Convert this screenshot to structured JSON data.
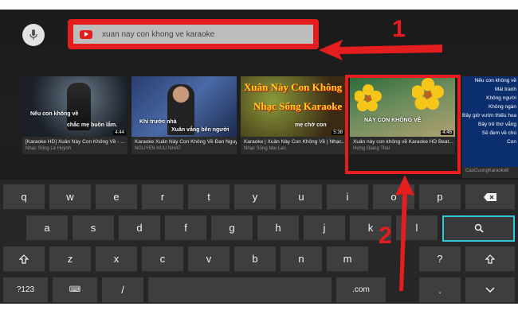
{
  "search": {
    "query": "xuan nay con khong ve karaoke"
  },
  "annotations": {
    "one": "1",
    "two": "2"
  },
  "videos": [
    {
      "title": "[Karaoke HD] Xuân Này Con Không Về - ...",
      "channel": "Nhạc Sống Lê Huỳnh",
      "duration": "4:44",
      "captions": [
        "Nếu con không về",
        "chắc mẹ buồn lắm."
      ]
    },
    {
      "title": "Karaoke Xuân Này Con Không Về Đan Nguyên",
      "channel": "NGUYEN HUU NHAT",
      "duration": "",
      "captions": [
        "Khi trước nhà",
        "Xuân vắng bên người"
      ]
    },
    {
      "title": "Karaoke | Xuân Này Con Không Về | Nhạc...",
      "channel": "Nhạc Sống Mai Lan",
      "duration": "5:38",
      "captions": [
        "Xuân Này Con Không Về",
        "Nhạc Sống Karaoke",
        "mẹ chờ con"
      ]
    },
    {
      "title": "Xuân này con không về  Karaoke HD   Beat...",
      "channel": "Hưng Giang Thái",
      "duration": "4:46",
      "captions": [
        "NÀY CON KHÔNG VỀ"
      ]
    }
  ],
  "side_video": {
    "lines": [
      "Nếu con không về",
      "Mái tranh",
      "Không người",
      "Không ngàn",
      "Bây giờ vườn thiếu hoa",
      "Bây trẻ thơ vắng",
      "Sẽ đem về chú",
      "Con"
    ],
    "channel": "CaoCuongKaraoke8"
  },
  "keyboard": {
    "row1": [
      "q",
      "w",
      "e",
      "r",
      "t",
      "y",
      "u",
      "i",
      "o",
      "p"
    ],
    "row2": [
      "a",
      "s",
      "d",
      "f",
      "g",
      "h",
      "j",
      "k",
      "l"
    ],
    "row3": [
      "z",
      "x",
      "c",
      "v",
      "b",
      "n",
      "m",
      "?"
    ],
    "row4": [
      "?123",
      "⌨",
      "/",
      ".com",
      "."
    ]
  }
}
